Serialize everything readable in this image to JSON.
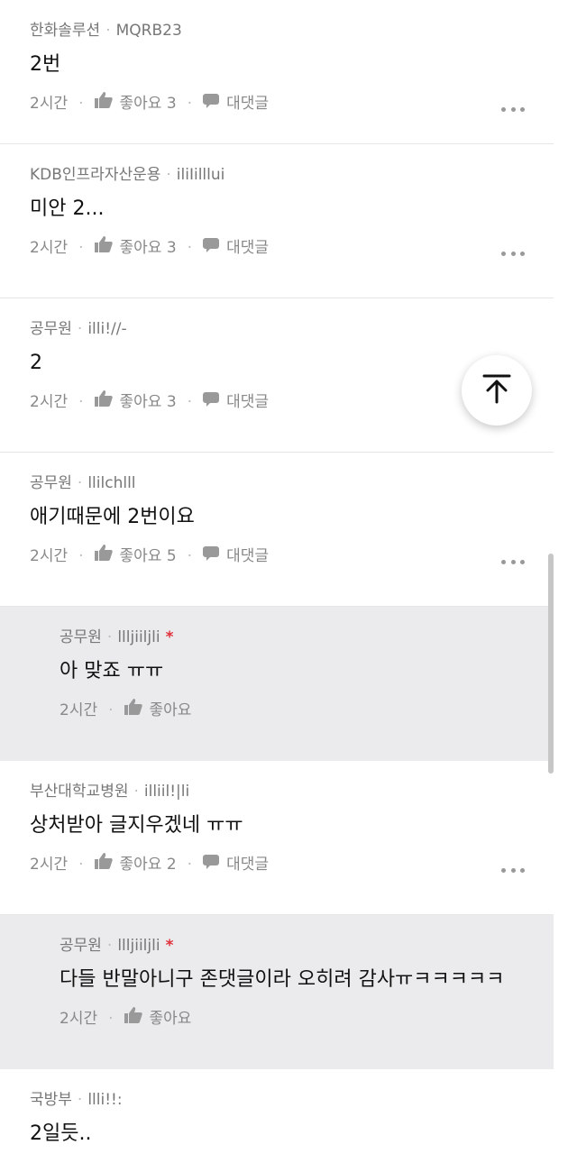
{
  "comments": [
    {
      "company": "한화솔루션",
      "nickname": "MQRB23",
      "text": "2번",
      "time": "2시간",
      "like_label": "좋아요",
      "like_count": "3",
      "reply_label": "대댓글",
      "reply": false,
      "author": false
    },
    {
      "company": "KDB인프라자산운용",
      "nickname": "iliIilllui",
      "text": "미안 2...",
      "time": "2시간",
      "like_label": "좋아요",
      "like_count": "3",
      "reply_label": "대댓글",
      "reply": false,
      "author": false
    },
    {
      "company": "공무원",
      "nickname": "illi!//-",
      "text": "2",
      "time": "2시간",
      "like_label": "좋아요",
      "like_count": "3",
      "reply_label": "대댓글",
      "reply": false,
      "author": false
    },
    {
      "company": "공무원",
      "nickname": "llilchlll",
      "text": "애기때문에 2번이요",
      "time": "2시간",
      "like_label": "좋아요",
      "like_count": "5",
      "reply_label": "대댓글",
      "reply": false,
      "author": false
    },
    {
      "company": "공무원",
      "nickname": "llljiiljli",
      "text": "아 맞죠 ㅠㅠ",
      "time": "2시간",
      "like_label": "좋아요",
      "like_count": "",
      "reply_label": "",
      "reply": true,
      "author": true
    },
    {
      "company": "부산대학교병원",
      "nickname": "illiil!|li",
      "text": "상처받아 글지우겠네 ㅠㅠ",
      "time": "2시간",
      "like_label": "좋아요",
      "like_count": "2",
      "reply_label": "대댓글",
      "reply": false,
      "author": false
    },
    {
      "company": "공무원",
      "nickname": "llljiiljli",
      "text": "다들 반말아니구 존댓글이라 오히려 감사ㅠㅋㅋㅋㅋㅋ",
      "time": "2시간",
      "like_label": "좋아요",
      "like_count": "",
      "reply_label": "",
      "reply": true,
      "author": true
    },
    {
      "company": "국방부",
      "nickname": "llli!!:",
      "text": "2일듯..",
      "time": "",
      "like_label": "",
      "like_count": "",
      "reply_label": "",
      "reply": false,
      "author": false
    }
  ],
  "icons": {
    "like": "thumbs-up-icon",
    "reply": "speech-bubble-icon",
    "more": "more-dots-icon",
    "scroll_top": "arrow-up-to-top-icon"
  },
  "author_marker": "*",
  "colors": {
    "reply_bg": "#ebebed",
    "author_marker": "#e0303a"
  }
}
